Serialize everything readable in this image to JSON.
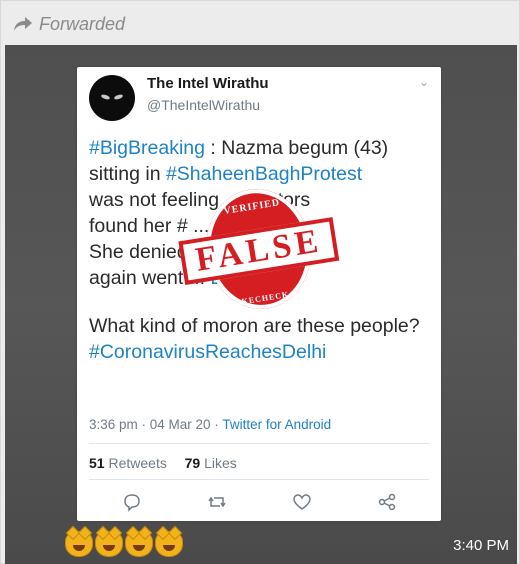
{
  "forwarded": {
    "label": "Forwarded",
    "icon": "forward-arrow-icon"
  },
  "tweet": {
    "name": "The Intel Wirathu",
    "handle": "@TheIntelWirathu",
    "lines": [
      {
        "tag": "#BigBreaking",
        "text": " : Nazma begum (43)"
      },
      {
        "text": "sitting in ",
        "tag": "#ShaheenBaghProtest"
      },
      {
        "text": "was not feeling ... doctors"
      },
      {
        "text": "found her # ... positive."
      },
      {
        "text": "She denied ... and"
      },
      {
        "text": "again went ... ",
        "tag": "Bagh",
        "tail": "."
      }
    ],
    "question": "What kind of moron are these people?",
    "hashtag": "#CoronavirusReachesDelhi",
    "time": "3:36 pm · 04 Mar 20 · ",
    "via": "Twitter for Android",
    "retweets": "51",
    "retweets_label": "Retweets",
    "likes": "79",
    "likes_label": "Likes",
    "actions": [
      "reply-icon",
      "retweet-icon",
      "like-icon",
      "share-icon"
    ]
  },
  "stamp": {
    "top": "VERIFIED",
    "main": "FALSE",
    "bottom": "FAKECHECK.AI",
    "color": "#d41e22"
  },
  "message": {
    "emoji_count": 4,
    "time": "3:40 PM"
  }
}
